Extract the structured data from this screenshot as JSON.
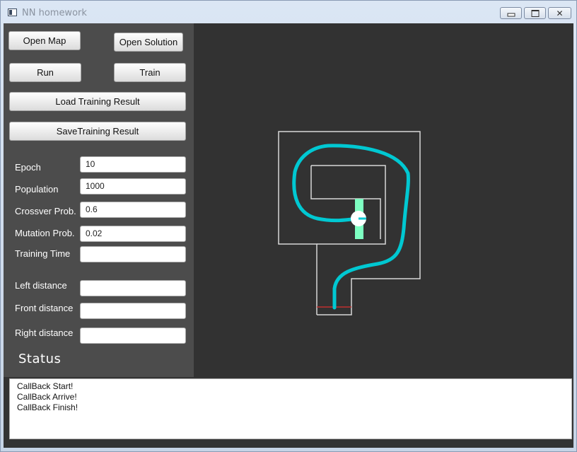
{
  "window": {
    "title": "NN homework"
  },
  "buttons": {
    "open_map": "Open Map",
    "open_solution": "Open Solution",
    "run": "Run",
    "train": "Train",
    "load_training": "Load Training Result",
    "save_training": "SaveTraining Result"
  },
  "params": {
    "epoch_label": "Epoch",
    "epoch_value": "10",
    "population_label": "Population",
    "population_value": "1000",
    "crossover_label": "Crossver Prob.",
    "crossover_value": "0.6",
    "mutation_label": "Mutation Prob.",
    "mutation_value": "0.02",
    "training_time_label": "Training Time",
    "training_time_value": "",
    "left_label": "Left distance",
    "left_value": "",
    "front_label": "Front distance",
    "front_value": "",
    "right_label": "Right distance",
    "right_value": ""
  },
  "status": {
    "heading": "Status",
    "log": [
      " CallBack Start!",
      "CallBack Arrive!",
      " CallBack Finish!"
    ]
  },
  "colors": {
    "path": "#00c8d2",
    "goal_zone": "#7effc2",
    "walls": "#d8d8d8",
    "start_line": "#c03030"
  }
}
